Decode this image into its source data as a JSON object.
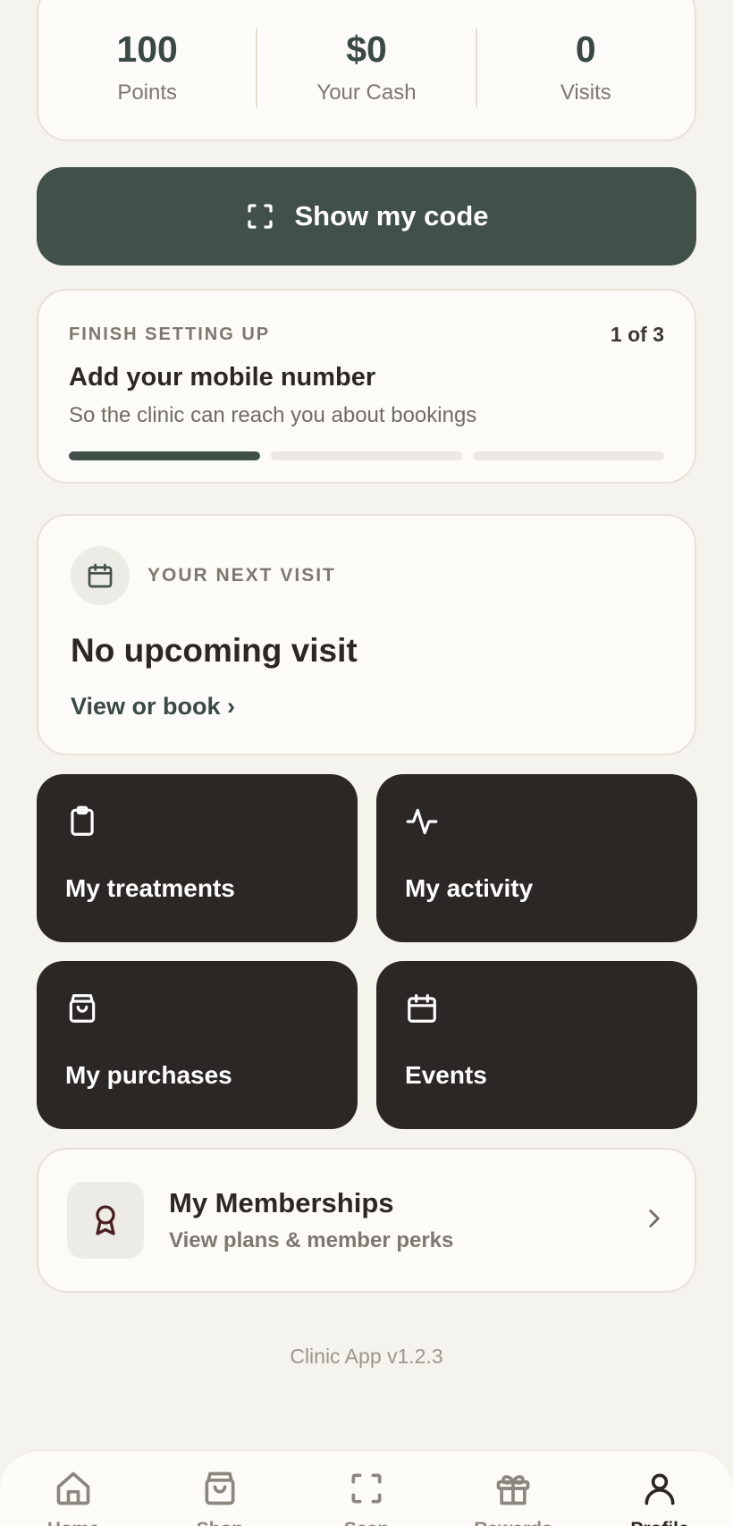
{
  "stats": [
    {
      "value": "100",
      "label": "Points"
    },
    {
      "value": "$0",
      "label": "Your Cash"
    },
    {
      "value": "0",
      "label": "Visits"
    }
  ],
  "show_code": {
    "label": "Show my code",
    "icon": "scan-icon"
  },
  "setup": {
    "eyebrow": "FINISH SETTING UP",
    "count": "1 of 3",
    "title": "Add your mobile number",
    "subtitle": "So the clinic can reach you about bookings",
    "progress_completed": 1,
    "progress_total": 3
  },
  "next_visit": {
    "eyebrow": "YOUR NEXT VISIT",
    "title": "No upcoming visit",
    "link": "View or book ›",
    "icon": "calendar-icon"
  },
  "tiles": [
    {
      "label": "My treatments",
      "icon": "clipboard-icon"
    },
    {
      "label": "My activity",
      "icon": "activity-icon"
    },
    {
      "label": "My purchases",
      "icon": "shopping-bag-icon"
    },
    {
      "label": "Events",
      "icon": "calendar-icon"
    }
  ],
  "memberships": {
    "title": "My Memberships",
    "subtitle": "View plans & member perks",
    "icon": "award-ribbon-icon"
  },
  "version": "Clinic App v1.2.3",
  "bottom_nav": [
    {
      "label": "Home",
      "icon": "home-icon",
      "active": false
    },
    {
      "label": "Shop",
      "icon": "shopping-bag-icon",
      "active": false
    },
    {
      "label": "Scan",
      "icon": "scan-icon",
      "active": false
    },
    {
      "label": "Rewards",
      "icon": "gift-icon",
      "active": false
    },
    {
      "label": "Profile",
      "icon": "user-icon",
      "active": true
    }
  ],
  "colors": {
    "background": "#f5f3ee",
    "card": "#fcfbf8",
    "primary_green": "#415048",
    "tile_dark": "#2b2724",
    "award_icon": "#4a1e22"
  }
}
